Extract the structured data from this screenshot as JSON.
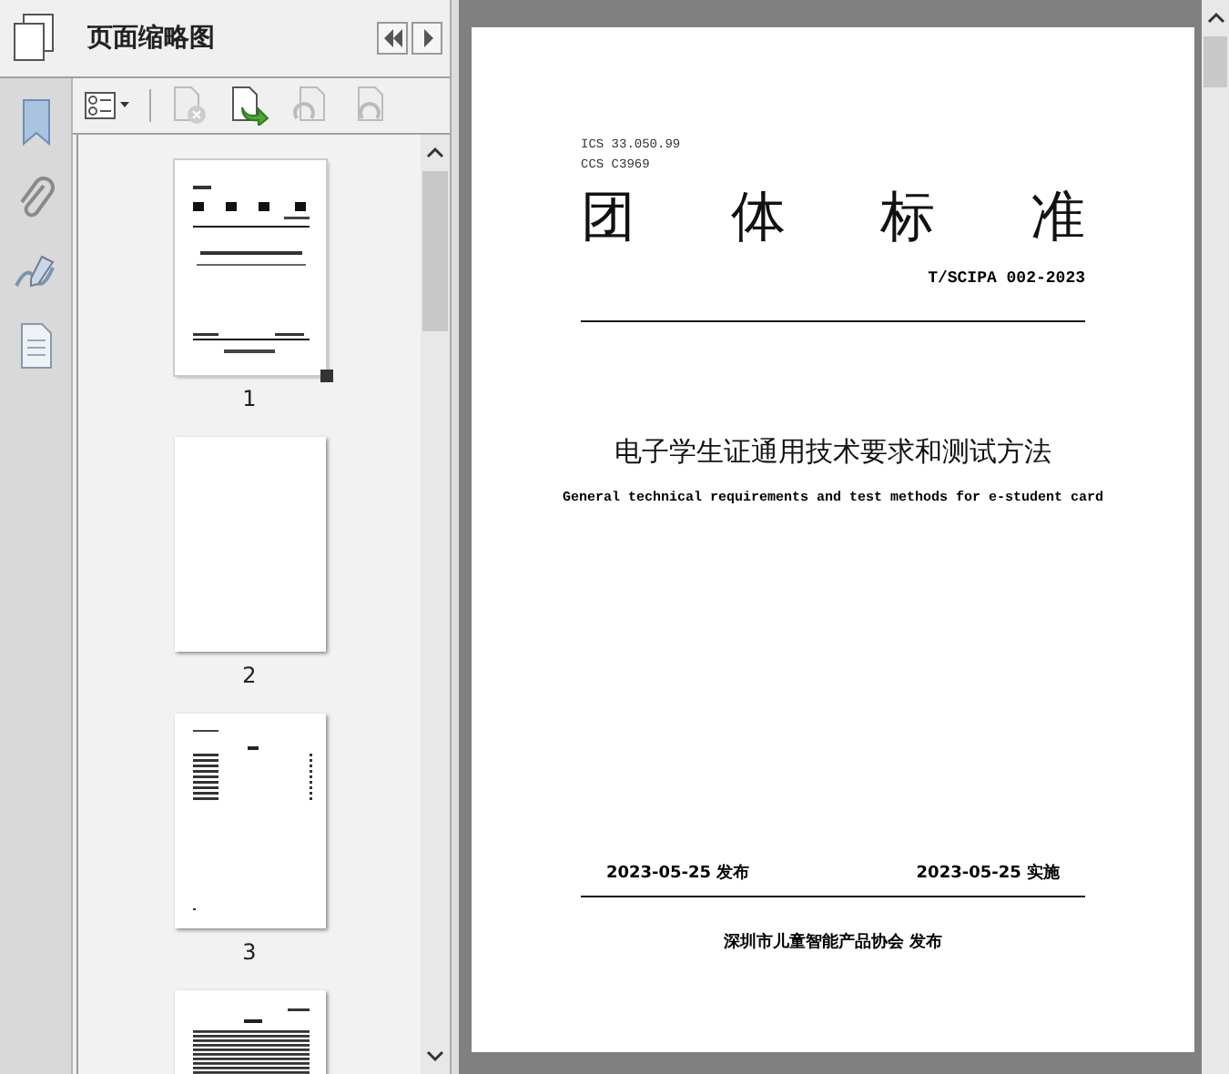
{
  "panel": {
    "title": "页面缩略图"
  },
  "thumbnails": [
    {
      "kind": "cover",
      "label": "1",
      "selected": true
    },
    {
      "kind": "blank",
      "label": "2",
      "selected": false
    },
    {
      "kind": "toc",
      "label": "3",
      "selected": false
    },
    {
      "kind": "text",
      "selected": false
    }
  ],
  "document": {
    "ics": "ICS 33.050.99",
    "ccs": "CCS C3969",
    "title_chars": [
      "团",
      "体",
      "标",
      "准"
    ],
    "number": "T/SCIPA 002-2023",
    "title_zh": "电子学生证通用技术要求和测试方法",
    "title_en": "General technical requirements and test methods for e-student card",
    "publish_date": "2023-05-25 发布",
    "effective_date": "2023-05-25 实施",
    "publisher": "深圳市儿童智能产品协会 发布"
  }
}
